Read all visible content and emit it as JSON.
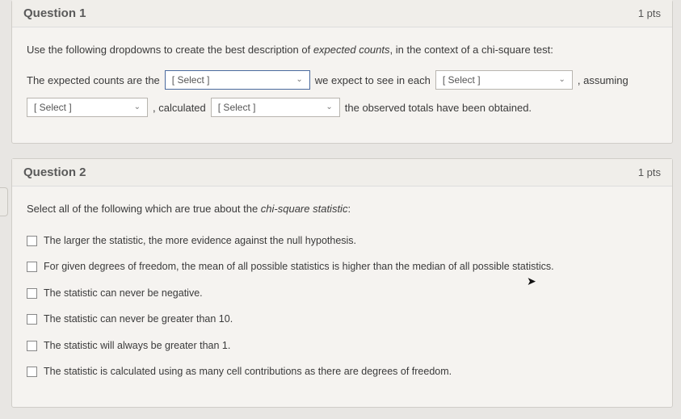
{
  "q1": {
    "title": "Question 1",
    "pts": "1 pts",
    "prompt_a": "Use the following dropdowns to create the best description of ",
    "prompt_em": "expected counts",
    "prompt_b": ", in the context of a chi-square test:",
    "line1_a": "The expected counts are the",
    "dd1": "[ Select ]",
    "line1_b": "we expect to see in each",
    "dd2": "[ Select ]",
    "line1_c": ", assuming",
    "dd3": "[ Select ]",
    "line2_a": ", calculated",
    "dd4": "[ Select ]",
    "line2_b": "the observed totals have been obtained."
  },
  "q2": {
    "title": "Question 2",
    "pts": "1 pts",
    "prompt_a": "Select all of the following which are true about the ",
    "prompt_em": "chi-square statistic",
    "prompt_b": ":",
    "options": [
      "The larger the statistic, the more evidence against the null hypothesis.",
      "For given degrees of freedom, the mean of all possible statistics is higher than the median of all possible statistics.",
      "The statistic can never be negative.",
      "The statistic can never be greater than 10.",
      "The statistic will always be greater than 1.",
      "The statistic is calculated using as many cell contributions as there are degrees of freedom."
    ]
  }
}
